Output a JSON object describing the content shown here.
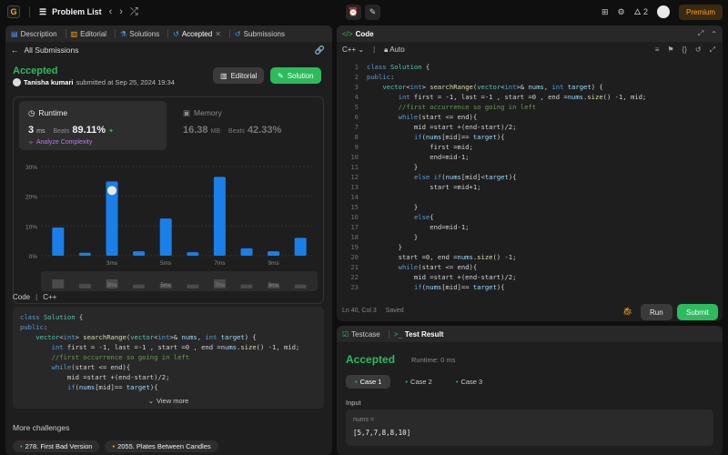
{
  "nav": {
    "logo": "G",
    "title": "Problem List",
    "premium": "Premium",
    "streak": "2"
  },
  "left_tabs": {
    "description": "Description",
    "editorial": "Editorial",
    "solutions": "Solutions",
    "accepted": "Accepted",
    "submissions": "Submissions"
  },
  "submission": {
    "back_label": "All Submissions",
    "status": "Accepted",
    "user": "Tanisha kumari",
    "submitted_text": "submitted at Sep 25, 2024 19:34",
    "editorial_btn": "Editorial",
    "solution_btn": "Solution"
  },
  "runtime": {
    "label": "Runtime",
    "value": "3",
    "unit": "ms",
    "beats_label": "Beats",
    "beats": "89.11%",
    "analyze": "Analyze Complexity"
  },
  "memory": {
    "label": "Memory",
    "value": "16.38",
    "unit": "MB",
    "beats_label": "Beats",
    "beats": "42.33%"
  },
  "chart_data": {
    "type": "bar",
    "yticks": [
      "30%",
      "20%",
      "10%",
      "0%"
    ],
    "ylim": [
      0,
      30
    ],
    "xticks": [
      "3ms",
      "5ms",
      "7ms",
      "9ms"
    ],
    "values": [
      9.5,
      1,
      25,
      1.5,
      12.5,
      1.2,
      26.5,
      2.5,
      1.5,
      6
    ],
    "mini_values": [
      1,
      0.4,
      1,
      0.3,
      0.4,
      0.3,
      1,
      0.3,
      0.4,
      0.3
    ],
    "highlight_index": 2,
    "bar_color": "#1a7fe8",
    "mini_color": "#4a4a4a"
  },
  "code_section": {
    "label": "Code",
    "lang": "C++",
    "view_more": "View more"
  },
  "more": {
    "title": "More challenges",
    "items": [
      "278. First Bad Version",
      "2055. Plates Between Candles"
    ]
  },
  "editor": {
    "title": "Code",
    "lang": "C++",
    "mode": "Auto",
    "status_pos": "Ln 40, Col 3",
    "status_saved": "Saved",
    "run": "Run",
    "submit": "Submit",
    "lines": [
      "class Solution {",
      "public:",
      "    vector<int> searchRange(vector<int>& nums, int target) {",
      "        int first = -1, last =-1 , start =0 , end =nums.size() -1, mid;",
      "        //first occurrence so going in left",
      "        while(start <= end){",
      "            mid =start +(end-start)/2;",
      "            if(nums[mid]== target){",
      "                first =mid;",
      "                end=mid-1;",
      "            }",
      "            else if(nums[mid]<target){",
      "                start =mid+1;",
      "",
      "            }",
      "            else{",
      "                end=mid-1;",
      "            }",
      "        }",
      "        start =0, end =nums.size() -1;",
      "        while(start <= end){",
      "            mid =start +(end-start)/2;",
      "            if(nums[mid]== target){"
    ]
  },
  "testpanel": {
    "testcase_tab": "Testcase",
    "result_tab": "Test Result",
    "status": "Accepted",
    "runtime": "Runtime: 0 ms",
    "cases": [
      "Case 1",
      "Case 2",
      "Case 3"
    ],
    "input_label": "Input",
    "param_name": "nums =",
    "param_value": "[5,7,7,8,8,10]"
  }
}
